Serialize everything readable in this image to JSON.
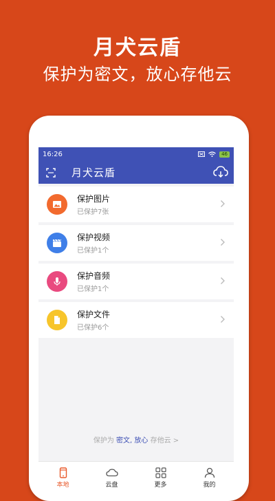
{
  "promo": {
    "title": "月犬云盾",
    "subtitle": "保护为密文，放心存他云"
  },
  "status_bar": {
    "time": "16:26",
    "battery": "46"
  },
  "app_bar": {
    "title": "月犬云盾"
  },
  "items": [
    {
      "title": "保护图片",
      "subtitle": "已保护7张",
      "color": "#F26A2E",
      "icon": "image-icon"
    },
    {
      "title": "保护视频",
      "subtitle": "已保护1个",
      "color": "#3F7FE8",
      "icon": "clapperboard-icon"
    },
    {
      "title": "保护音频",
      "subtitle": "已保护1个",
      "color": "#E94A7F",
      "icon": "microphone-icon"
    },
    {
      "title": "保护文件",
      "subtitle": "已保护6个",
      "color": "#F7C52B",
      "icon": "file-icon"
    }
  ],
  "footer": {
    "prefix": "保护为",
    "hl1": "密文",
    "comma": ",",
    "hl2": "放心",
    "suffix": "存他云",
    "arrow": ">"
  },
  "tabs": [
    {
      "label": "本地",
      "icon": "phone-icon",
      "active": true
    },
    {
      "label": "云盘",
      "icon": "cloud-icon",
      "active": false
    },
    {
      "label": "更多",
      "icon": "grid-icon",
      "active": false
    },
    {
      "label": "我的",
      "icon": "person-icon",
      "active": false
    }
  ],
  "colors": {
    "background": "#D7471A",
    "primary": "#3F51B5",
    "accent": "#E8592B"
  }
}
